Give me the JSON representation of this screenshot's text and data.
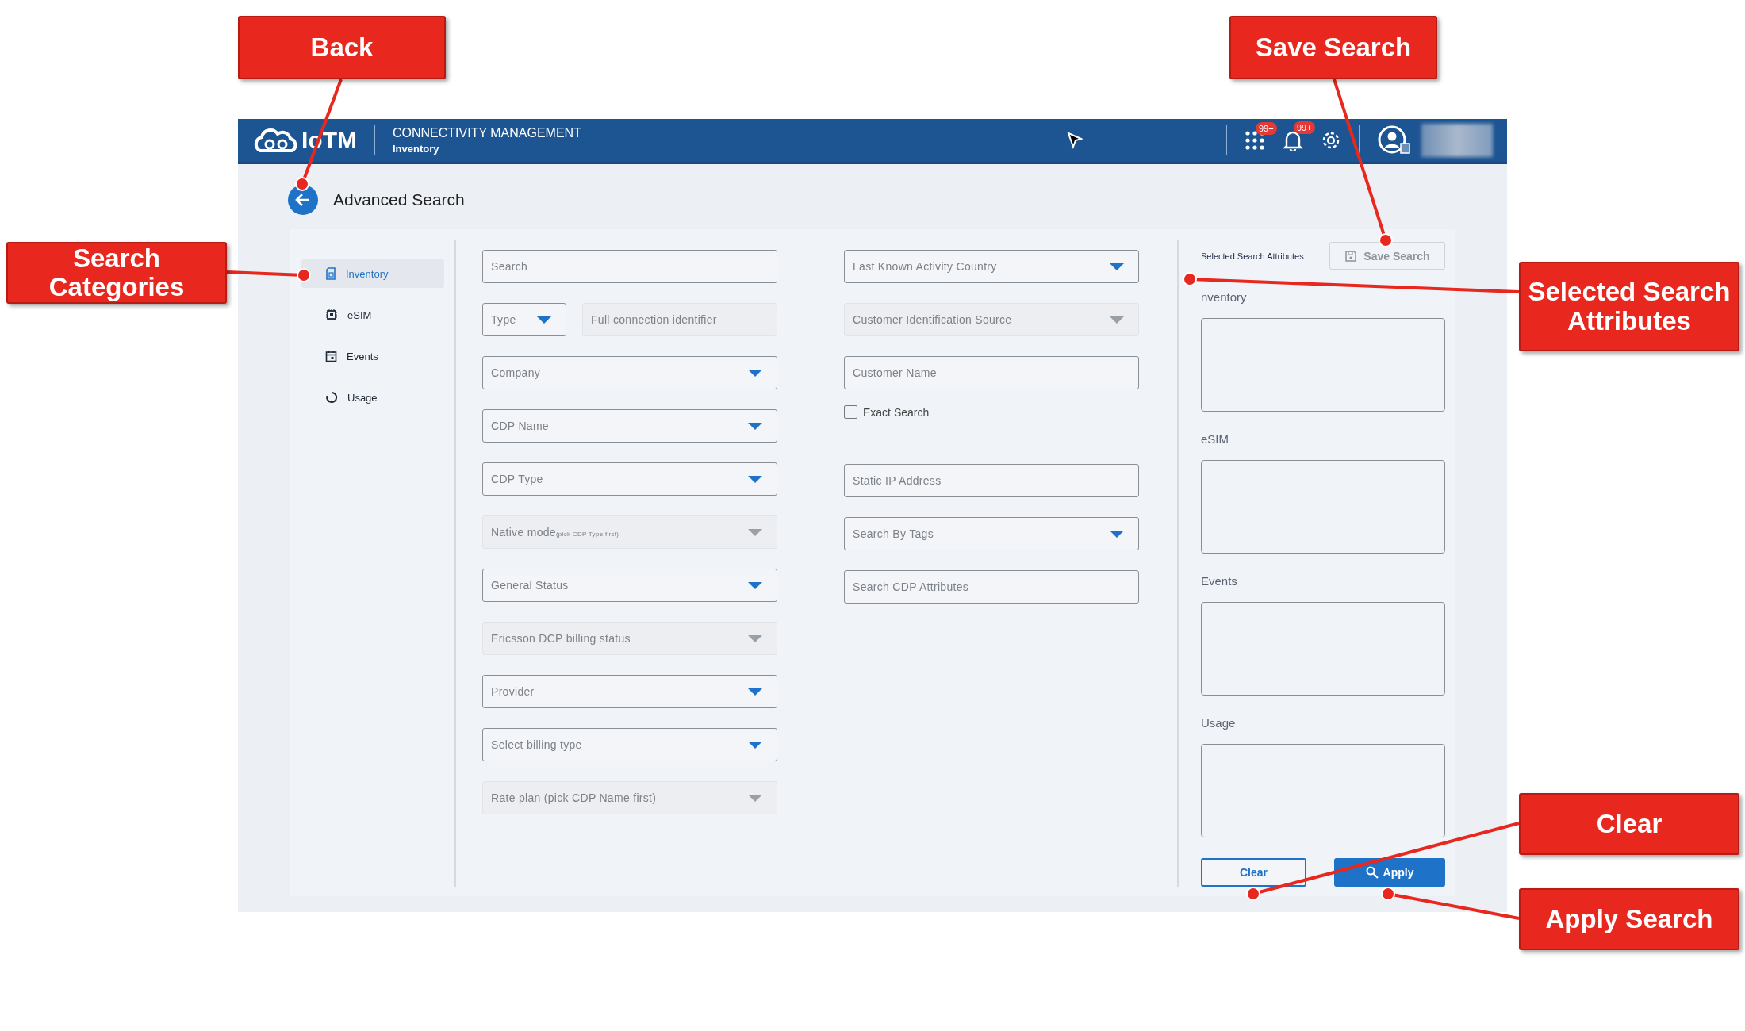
{
  "header": {
    "logo": "IoTM",
    "module": "CONNECTIVITY MANAGEMENT",
    "section": "Inventory",
    "badges": [
      "99+",
      "99+"
    ]
  },
  "page": {
    "title": "Advanced Search"
  },
  "categories": [
    {
      "label": "Inventory",
      "selected": true,
      "kind": "sim"
    },
    {
      "label": "eSIM",
      "selected": false,
      "kind": "chip"
    },
    {
      "label": "Events",
      "selected": false,
      "kind": "calendar"
    },
    {
      "label": "Usage",
      "selected": false,
      "kind": "ring"
    }
  ],
  "column_1": [
    {
      "fields": [
        {
          "kind": "input",
          "placeholder": "Search",
          "disabled": false
        }
      ]
    },
    {
      "fields": [
        {
          "kind": "select",
          "placeholder": "Type",
          "disabled": false,
          "narrow": true
        },
        {
          "kind": "input",
          "placeholder": "Full connection identifier",
          "disabled": true
        }
      ]
    },
    {
      "fields": [
        {
          "kind": "select",
          "placeholder": "Company",
          "disabled": false
        }
      ]
    },
    {
      "fields": [
        {
          "kind": "select",
          "placeholder": "CDP Name",
          "disabled": false
        }
      ]
    },
    {
      "fields": [
        {
          "kind": "select",
          "placeholder": "CDP Type",
          "disabled": false
        }
      ]
    },
    {
      "fields": [
        {
          "kind": "select",
          "placeholder": "Native mode",
          "hint": "(pick CDP Type first)",
          "disabled": true
        }
      ]
    },
    {
      "fields": [
        {
          "kind": "select",
          "placeholder": "General Status",
          "disabled": false
        }
      ]
    },
    {
      "fields": [
        {
          "kind": "select",
          "placeholder": "Ericsson DCP billing status",
          "disabled": true
        }
      ]
    },
    {
      "fields": [
        {
          "kind": "select",
          "placeholder": "Provider",
          "disabled": false
        }
      ]
    },
    {
      "fields": [
        {
          "kind": "select",
          "placeholder": "Select billing type",
          "disabled": false
        }
      ]
    },
    {
      "fields": [
        {
          "kind": "select",
          "placeholder": "Rate plan (pick CDP Name first)",
          "disabled": true
        }
      ]
    }
  ],
  "column_2": [
    {
      "kind": "select",
      "placeholder": "Last Known Activity Country",
      "disabled": false
    },
    {
      "kind": "select",
      "placeholder": "Customer Identification Source",
      "disabled": true
    },
    {
      "kind": "input",
      "placeholder": "Customer Name",
      "disabled": false
    },
    {
      "kind": "checkbox",
      "label": "Exact Search",
      "checked": false
    },
    {
      "kind": "input",
      "placeholder": "Static IP Address",
      "disabled": false
    },
    {
      "kind": "select",
      "placeholder": "Search By Tags",
      "disabled": false
    },
    {
      "kind": "input",
      "placeholder": "Search CDP Attributes",
      "disabled": false
    }
  ],
  "selected_panel": {
    "title": "Selected Search Attributes",
    "save_button": {
      "label": "Save Search",
      "disabled": true
    },
    "groups": [
      {
        "label": "nventory"
      },
      {
        "label": "eSIM"
      },
      {
        "label": "Events"
      },
      {
        "label": "Usage"
      }
    ],
    "clear_button": "Clear",
    "apply_button": "Apply"
  },
  "callouts": [
    {
      "label": "Back",
      "kind": "back"
    },
    {
      "label": "Save Search",
      "kind": "save"
    },
    {
      "label": "Search Categories",
      "kind": "categories"
    },
    {
      "label": "Selected Search Attributes",
      "kind": "selected"
    },
    {
      "label": "Clear",
      "kind": "clear"
    },
    {
      "label": "Apply Search",
      "kind": "apply"
    }
  ]
}
